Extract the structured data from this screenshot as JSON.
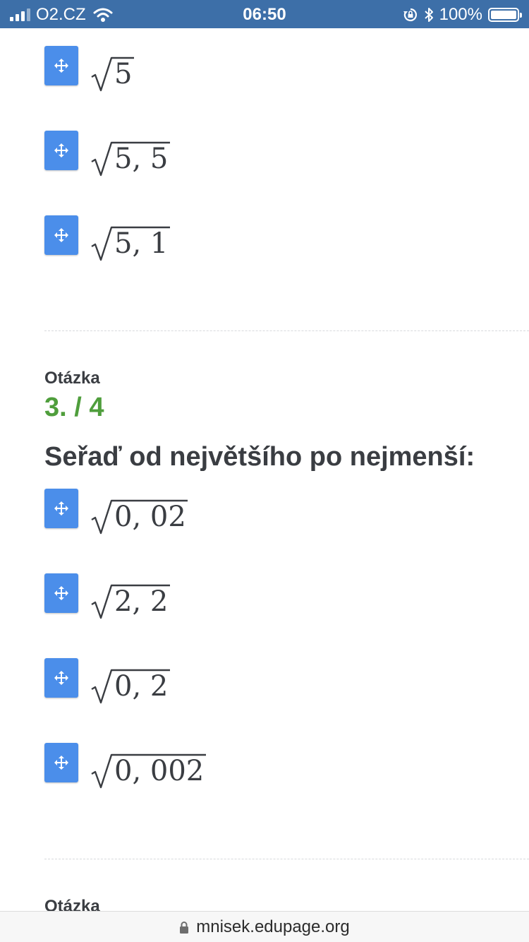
{
  "status_bar": {
    "carrier": "O2.CZ",
    "time": "06:50",
    "battery": "100%",
    "battery_level": 1.0,
    "signal_bars_active": 3,
    "signal_bars_total": 4,
    "icons": [
      "signal-icon",
      "wifi-icon",
      "rotation-lock-icon",
      "bluetooth-icon",
      "battery-icon"
    ]
  },
  "previous_question": {
    "answers": [
      "5",
      "5, 5",
      "5, 1"
    ]
  },
  "question": {
    "label": "Otázka",
    "number": "3. / 4",
    "text": "Seřaď od největšího po nejmenší:",
    "answers": [
      "0, 02",
      "2, 2",
      "0, 2",
      "0, 002"
    ]
  },
  "next_question": {
    "label": "Otázka"
  },
  "colors": {
    "status_bar": "#3d6fa8",
    "drag_handle": "#4b8eea",
    "question_number": "#4f9e3c",
    "text": "#3a3d42"
  },
  "url_bar": {
    "url": "mnisek.edupage.org"
  }
}
